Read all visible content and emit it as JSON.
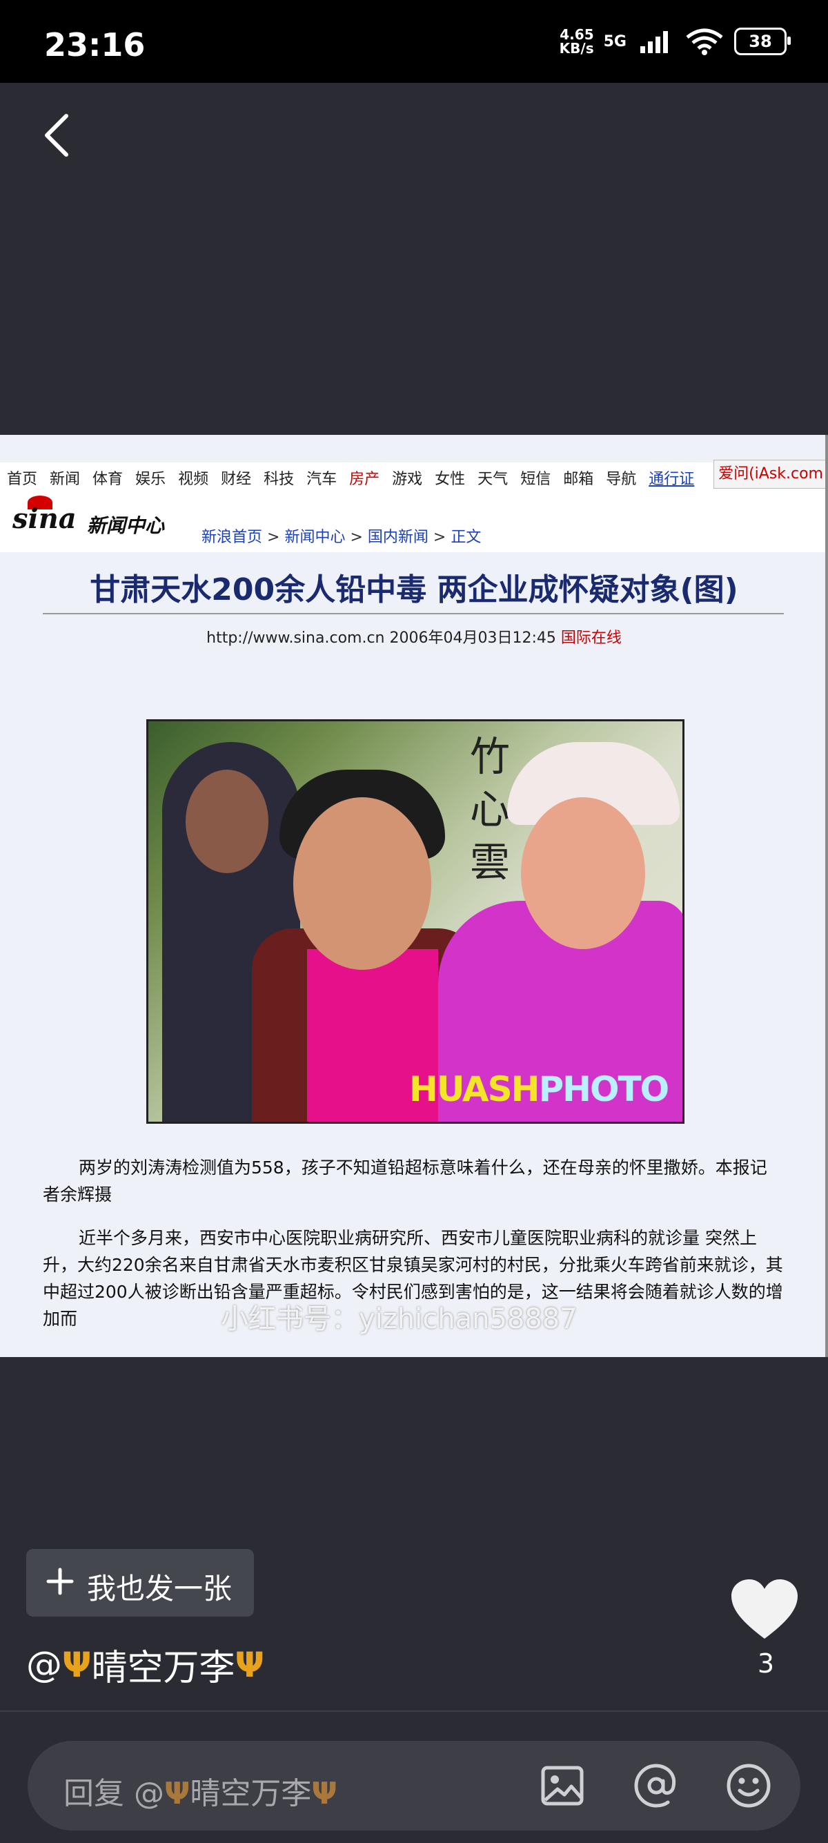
{
  "status_bar": {
    "time": "23:16",
    "net_speed_value": "4.65",
    "net_speed_unit": "KB/s",
    "network": "5G",
    "battery": "38"
  },
  "screenshot": {
    "nav_items": [
      "首页",
      "新闻",
      "体育",
      "娱乐",
      "视频",
      "财经",
      "科技",
      "汽车",
      "房产",
      "游戏",
      "女性",
      "天气",
      "短信",
      "邮箱",
      "导航"
    ],
    "nav_highlight": "房产",
    "nav_pass": "通行证",
    "iask": "爱问(iAsk.com",
    "logo": "sina",
    "section": "新闻中心",
    "breadcrumbs": [
      "新浪首页",
      "新闻中心",
      "国内新闻",
      "正文"
    ],
    "breadcrumb_sep": ">",
    "headline": "甘肃天水200余人铅中毒 两企业成怀疑对象(图)",
    "source_url_date": "http://www.sina.com.cn 2006年04月03日12:45",
    "source_name": "国际在线",
    "photo_watermark_a": "HUASH",
    "photo_watermark_b": "PHOTO",
    "photo_calligraphy": "竹 ⼼ 雲",
    "caption": "两岁的刘涛涛检测值为558，孩子不知道铅超标意味着什么，还在母亲的怀里撒娇。本报记者余辉摄",
    "paragraph": "近半个多月来，西安市中心医院职业病研究所、西安市儿童医院职业病科的就诊量 突然上升，大约220余名来自甘肃省天水市麦积区甘泉镇吴家河村的村民，分批乘火车跨省前来就诊，其中超过200人被诊断出铅含量严重超标。令村民们感到害怕的是，这一结果将会随着就诊人数的增加而",
    "overlay_watermark": "小红书号：yizhichan58887"
  },
  "post": {
    "post_button_label": "我也发一张",
    "author_prefix": "@",
    "author_name": "晴空万李",
    "likes": "3"
  },
  "reply_bar": {
    "placeholder_prefix": "回复 @",
    "placeholder_name": "晴空万李"
  },
  "colors": {
    "background": "#2b2c33",
    "accent_trident": "#e8a21b",
    "sina_red": "#c00000"
  },
  "icons": [
    "back-icon",
    "plus-icon",
    "heart-icon",
    "image-icon",
    "at-icon",
    "emoji-icon",
    "trident-icon"
  ]
}
